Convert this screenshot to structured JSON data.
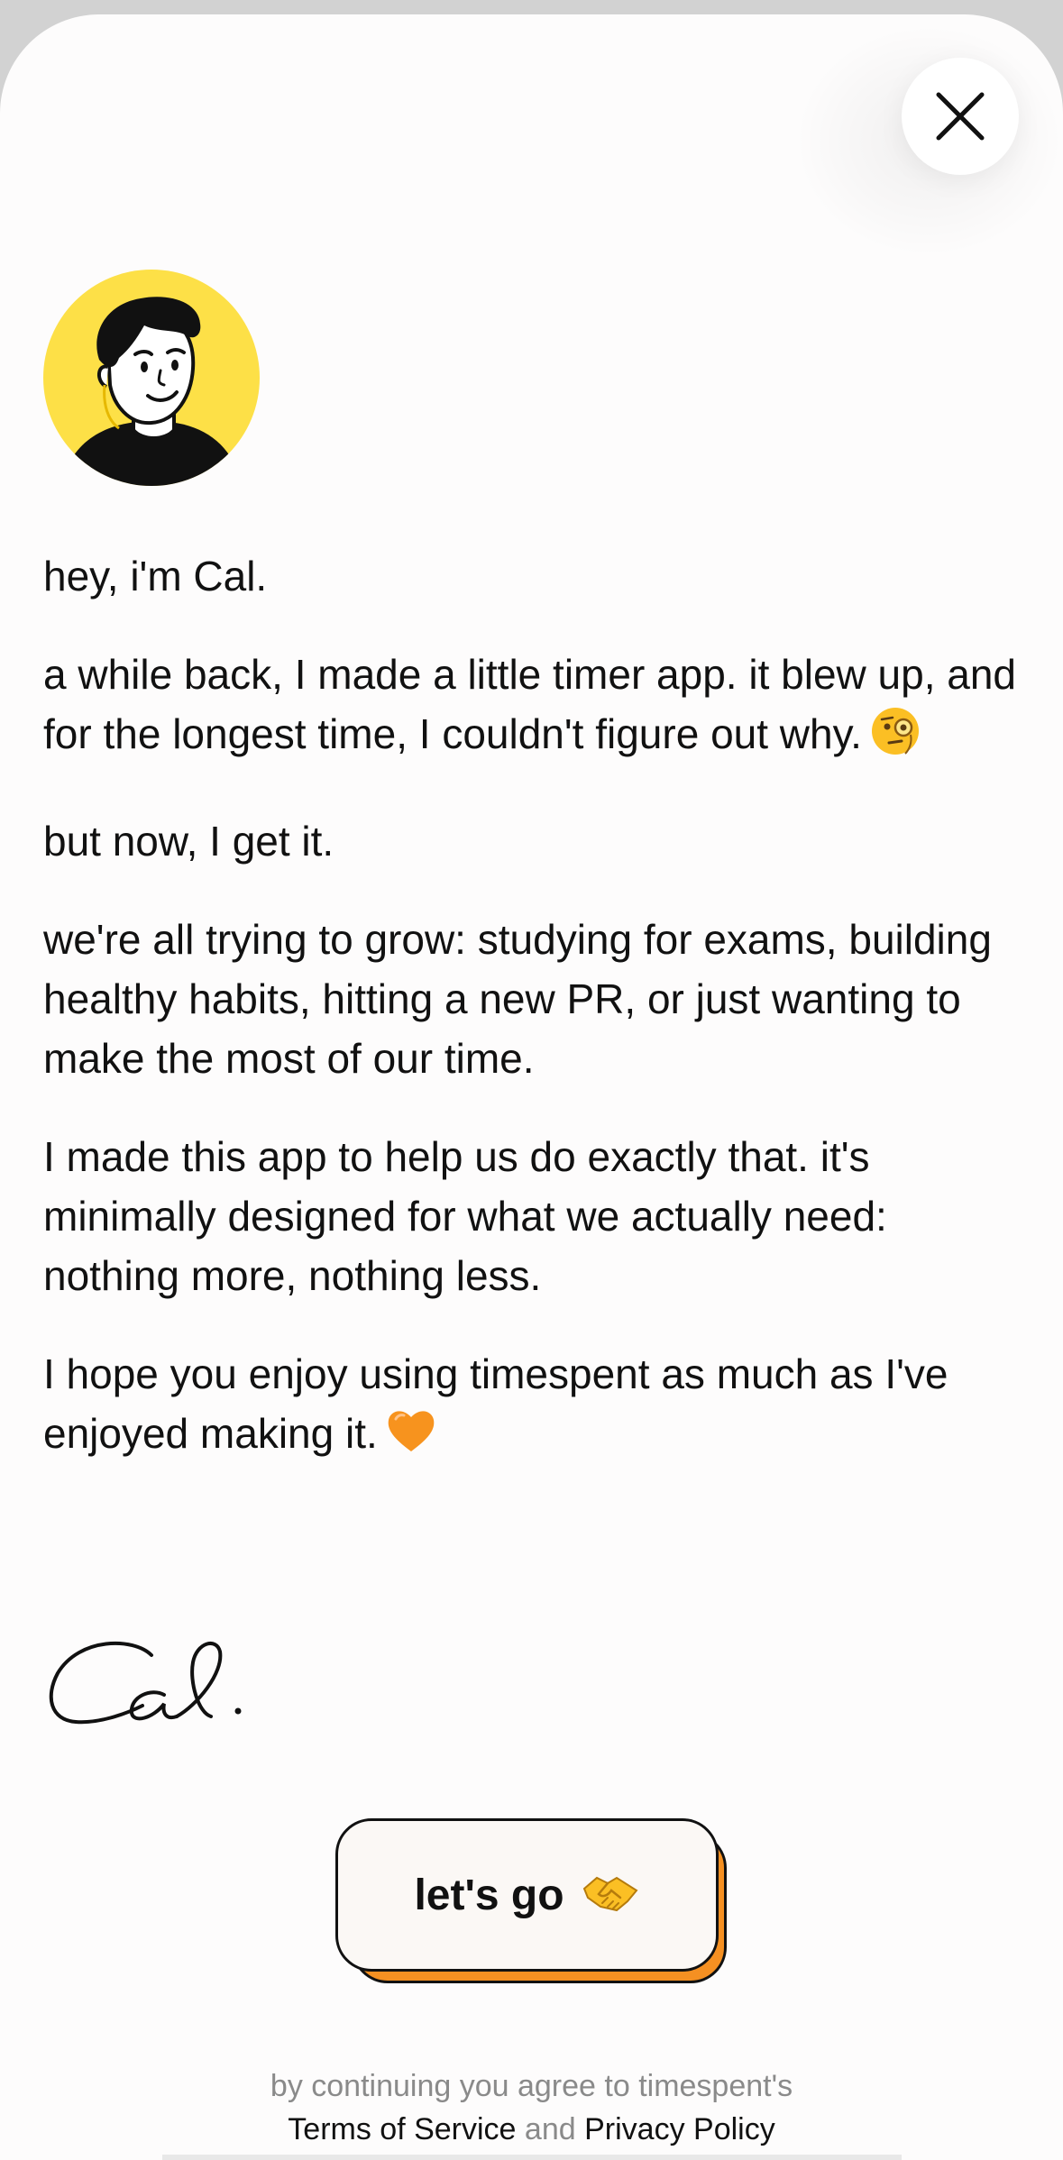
{
  "close_button": {
    "icon": "close-icon"
  },
  "avatar": {
    "icon": "avatar-illustration",
    "background_color": "#fde047"
  },
  "letter": {
    "greeting": "hey, i'm Cal.",
    "paragraph_2": "a while back, I made a little timer app. it blew up, and for the longest time, I couldn't figure out why.",
    "paragraph_2_emoji": "monocle-face-emoji",
    "paragraph_3": "but now, I get it.",
    "paragraph_4": "we're all trying to grow: studying for exams, building healthy habits, hitting a new PR, or just wanting to make the most of our time.",
    "paragraph_5": "I made this app to help us do exactly that. it's minimally designed for what we actually need: nothing more, nothing less.",
    "paragraph_6": "I hope you enjoy using timespent as much as I've enjoyed making it.",
    "paragraph_6_emoji": "orange-heart-emoji"
  },
  "signature": {
    "text": "Cal."
  },
  "cta": {
    "label": "let's go",
    "emoji": "handshake-emoji",
    "shadow_color": "#f59022"
  },
  "legal": {
    "line_1": "by continuing you agree to timespent's",
    "terms_link": "Terms of Service",
    "conjunction": "and",
    "privacy_link": "Privacy Policy"
  }
}
